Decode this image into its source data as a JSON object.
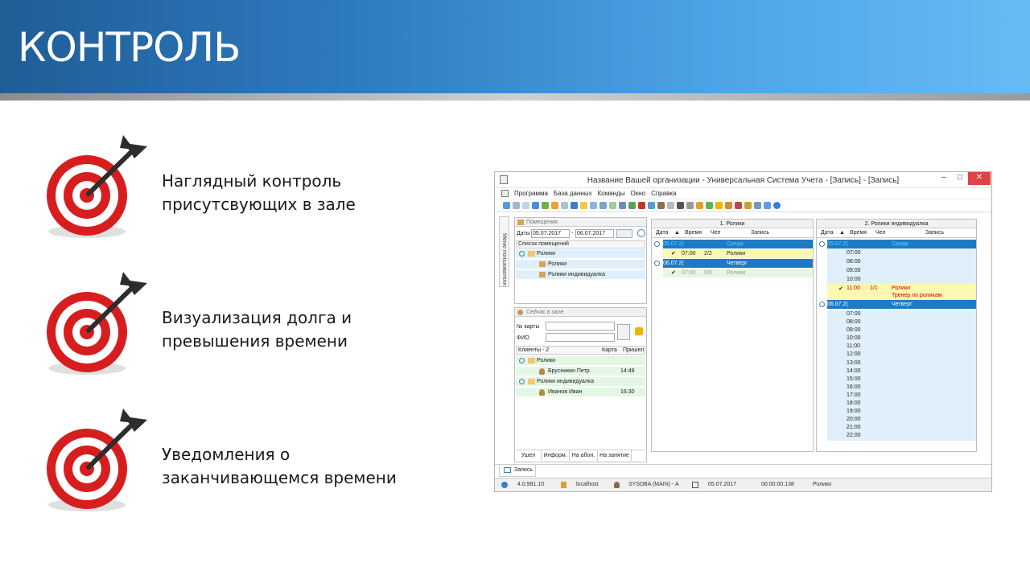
{
  "slide": {
    "title": "КОНТРОЛЬ",
    "bullets": [
      {
        "line1": "Наглядный контроль",
        "line2": "присутсвующих в зале"
      },
      {
        "line1": "Визуализация долга и",
        "line2": "превышения времени"
      },
      {
        "line1": "Уведомления о",
        "line2": "заканчивающемся времени"
      }
    ]
  },
  "app": {
    "title": "Название Вашей организации - Универсальная Система Учета - [Запись] - [Запись]",
    "window_buttons": {
      "minimize": "–",
      "maximize": "□",
      "close": "✕"
    },
    "menu": [
      "Программа",
      "База данных",
      "Команды",
      "Окно",
      "Справка"
    ],
    "sidebar_tab": "Меню пользователя",
    "rooms_panel": {
      "title": "Помещения",
      "dates_label": "Даты",
      "date_from": "05.07.2017",
      "dash": "-",
      "date_to": "06.07.2017",
      "list_header": "Список помещений",
      "tree": [
        {
          "label": "Ролики",
          "level": 0
        },
        {
          "label": "Ролики",
          "level": 1
        },
        {
          "label": "Ролики индивидуалка",
          "level": 1
        }
      ]
    },
    "now_panel": {
      "title": "Сейчас в зале",
      "card_label": "№ карты",
      "fio_label": "ФИО",
      "columns": [
        "Клиенты - 2",
        "Карта",
        "Пришел"
      ],
      "rows": [
        {
          "group": "Ролики",
          "name": "Брусникин Петр",
          "time": "14:48"
        },
        {
          "group": "Ролики индивидуалка",
          "name": "Иванов Иван",
          "time": "16:30"
        }
      ],
      "bottom_tabs": [
        "Ушел",
        "Информ.",
        "На абон.",
        "На занятие"
      ]
    },
    "schedule1": {
      "title": "1. Ролики",
      "columns": [
        "Дата",
        "Время",
        "Чел",
        "Запись"
      ],
      "rows": [
        {
          "type": "day",
          "date": "05.07.2(",
          "label": "Среда"
        },
        {
          "type": "slot",
          "check": "✔",
          "time": "07:00",
          "count": "2/2",
          "record": "Ролики"
        },
        {
          "type": "day",
          "date": "06.07.2(",
          "label": "Четверг"
        },
        {
          "type": "slot-gray",
          "check": "✔",
          "time": "07:00",
          "count": "0/0",
          "record": "Ролики"
        }
      ]
    },
    "schedule2": {
      "title": "2. Ролики индивидуалка",
      "columns": [
        "Дата",
        "Время",
        "Чел",
        "Запись"
      ],
      "day1": {
        "date": "05.07.2(",
        "label": "Среда"
      },
      "day1_times": [
        "07:00",
        "08:00",
        "09:00",
        "10:00"
      ],
      "highlight": {
        "check": "✔",
        "time": "11:00",
        "count": "1/1",
        "record": "Ролики",
        "record2": "Тренер по роликам"
      },
      "day2": {
        "date": "06.07.2(",
        "label": "Четверг"
      },
      "day2_times": [
        "07:00",
        "08:00",
        "09:00",
        "10:00",
        "11:00",
        "12:00",
        "13:00",
        "14:00",
        "15:00",
        "16:00",
        "17:00",
        "18:00",
        "19:00",
        "20:00",
        "21:00",
        "22:00"
      ]
    },
    "bottom_tab": "Запись",
    "status": {
      "version": "4.0.981.10",
      "host": "localhost",
      "user": "SYSDBA (MAIN) - A",
      "date": "05.07.2017",
      "timer": "00:00:00:138",
      "room": "Ролики"
    },
    "colors": {
      "day_row": "#1e7bc3",
      "slot_row": "#fdf8b0",
      "light_row": "#dff0fa",
      "green_row": "#e4f7e4",
      "alert_text": "#d40000"
    }
  }
}
